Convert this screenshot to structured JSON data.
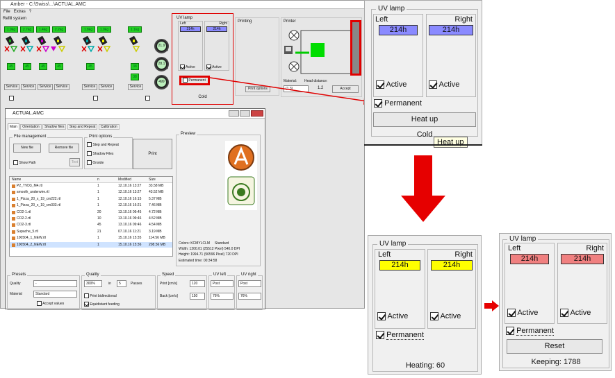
{
  "app": {
    "title": "Amber - C:\\Swiss\\...\\ACTUAL.AMC",
    "menu": [
      "File",
      "Extras",
      "?"
    ]
  },
  "refill": {
    "label": "Refill system",
    "weights": [
      "1.9kg",
      "2.7kg",
      "1.4kg",
      "2.2kg",
      "1.8kg",
      "1.0kg",
      "1.1kg"
    ],
    "levels": [
      "45",
      "45",
      "45",
      "45",
      "45",
      "38",
      "38"
    ],
    "service_labels": [
      "Service",
      "Service",
      "Service",
      "Service",
      "Service",
      "Service",
      "Service"
    ],
    "gauges": [
      "21.9",
      "28.1",
      "499"
    ],
    "gauge_units": [
      "°",
      "°"
    ]
  },
  "uv_small": {
    "title": "UV lamp",
    "left_label": "Left",
    "right_label": "Right",
    "left_value": "214h",
    "right_value": "214h",
    "active_left": "Active",
    "active_right": "Active",
    "permanent": "Permanent",
    "status": "Cold"
  },
  "printing": {
    "title": "Printing",
    "print_options_btn": "Print options"
  },
  "printer": {
    "title": "Printer",
    "material_label": "Material:",
    "material_value": "(1.3)",
    "head_distance_label": "Head distance:",
    "head_distance_value": "1.2",
    "accept_btn": "Accept"
  },
  "subwin": {
    "title": "ACTUAL.AMC",
    "tabs": [
      "Main",
      "Orientation",
      "Shadow files",
      "Step and Repeat",
      "Calibration"
    ],
    "file_management": "File management",
    "new_file": "New file",
    "remove_file": "Remove file",
    "show_path": "Show Path",
    "text_btn": "Text",
    "print_options": "Print options",
    "step_and_repeat": "Step and Repeat",
    "shadow_files": "Shadow Files",
    "onside": "Onside",
    "print_btn": "Print",
    "preview": "Preview",
    "columns": [
      "Name",
      "n",
      "Modified",
      "Size"
    ],
    "files": [
      {
        "name": "P2_TVD3_M4.rtl",
        "n": "1",
        "modified": "12.10.16 13:27",
        "size": "33.58 MB"
      },
      {
        "name": "smooth_underwire.rtl",
        "n": "1",
        "modified": "12.10.16 13:27",
        "size": "43.52 MB"
      },
      {
        "name": "1_Pizza_20_x_19_cm222.rtl",
        "n": "1",
        "modified": "12.10.16 16:15",
        "size": "5.37 MB"
      },
      {
        "name": "1_Pizza_20_x_19_cm333.rtl",
        "n": "1",
        "modified": "12.10.16 16:21",
        "size": "7.46 MB"
      },
      {
        "name": "CO2-1.rtl",
        "n": "20",
        "modified": "13.10.16 09:45",
        "size": "4.72 MB"
      },
      {
        "name": "CO2-2.rtl",
        "n": "10",
        "modified": "13.10.16 09:46",
        "size": "4.52 MB"
      },
      {
        "name": "CO2-3.rtl",
        "n": "45",
        "modified": "13.10.16 09:46",
        "size": "4.54 MB"
      },
      {
        "name": "Supache_5.rtl",
        "n": "21",
        "modified": "07.10.16 11:21",
        "size": "3.19 MB"
      },
      {
        "name": "100504_1_NEW.rtl",
        "n": "1",
        "modified": "15.10.16 15:35",
        "size": "114.56 MB"
      },
      {
        "name": "100504_2_NEW.rtl",
        "n": "1",
        "modified": "15.10.16 15:36",
        "size": "208.56 MB"
      }
    ],
    "colors_label": "Colors: KCMYLCLM",
    "mode": "Standard",
    "width_line": "Width: 1200.01 (25512 Pixel) 540.0 DPI",
    "height_line": "Height: 1994.71 (56596 Pixel) 720 DPI",
    "estimated": "Estimated time: 00:34:58",
    "presets": "Presets",
    "quality_group": "Quality",
    "quality_label": "Quality",
    "quality_value": "-",
    "material_label": "Material",
    "material_value": "Standard",
    "accept_values": "Accept values",
    "quality_pct": "300%",
    "in_label": "in",
    "passes_value": "5",
    "passes_label": "Passes",
    "print_bidirectional": "Print bidirectional",
    "equidistant": "Equidistant feeding",
    "speed": "Speed",
    "print_speed_label": "Print [cm/s]",
    "print_speed": "120",
    "back_speed_label": "Back [cm/s]",
    "back_speed": "150",
    "uv_left": "UV left",
    "uv_right": "UV right",
    "uv_left_mode": "Post",
    "uv_right_mode": "Post",
    "uv_left_pct": "76%",
    "uv_right_pct": "76%"
  },
  "zoom_top": {
    "title": "UV lamp",
    "left_label": "Left",
    "right_label": "Right",
    "left_value": "214h",
    "right_value": "214h",
    "active_left": "Active",
    "active_right": "Active",
    "permanent": "Permanent",
    "heat_up_btn": "Heat up",
    "status": "Cold",
    "tooltip": "Heat up"
  },
  "zoom_heating": {
    "title": "UV lamp",
    "left_label": "Left",
    "right_label": "Right",
    "left_value": "214h",
    "right_value": "214h",
    "active_left": "Active",
    "active_right": "Active",
    "permanent": "Permanent",
    "status": "Heating: 60"
  },
  "zoom_keeping": {
    "title": "UV lamp",
    "left_label": "Left",
    "right_label": "Right",
    "left_value": "214h",
    "right_value": "214h",
    "active_left": "Active",
    "active_right": "Active",
    "permanent": "Permanent",
    "reset_btn": "Reset",
    "status": "Keeping: 1788"
  },
  "colors": {
    "lamp_cold": "#8a8aff",
    "lamp_heating": "#ffff00",
    "lamp_keeping": "#f08080",
    "highlight": "#e00000",
    "preview_green": "#00dd00"
  }
}
